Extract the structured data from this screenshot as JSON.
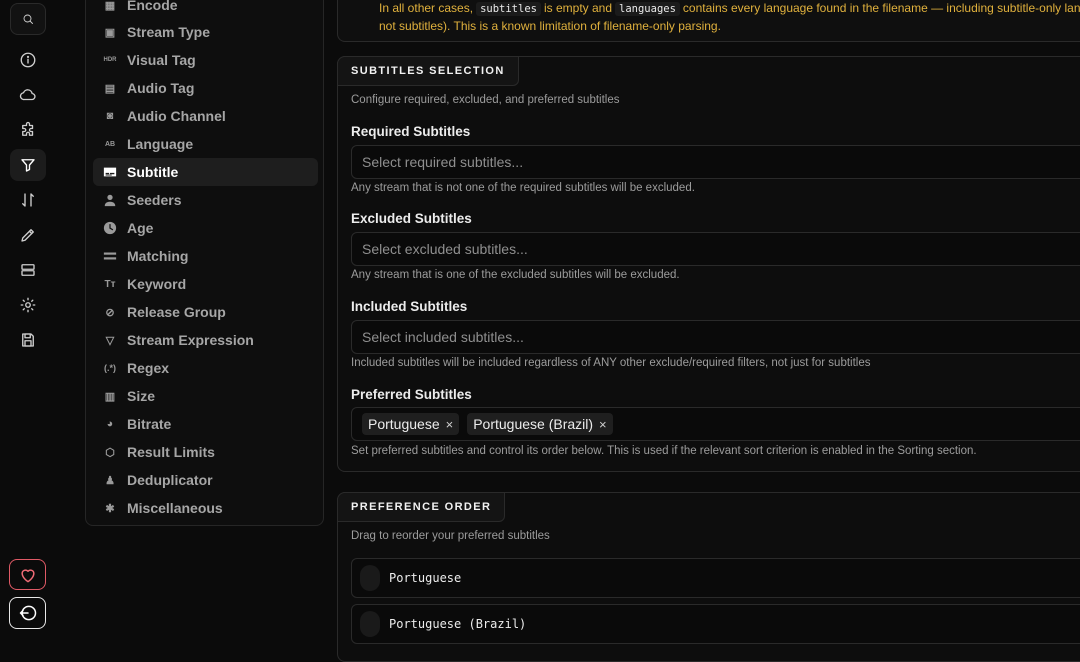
{
  "notice": {
    "line1_pre": "In all other cases,",
    "code1": "subtitles",
    "line1_mid": "is empty and",
    "code2": "languages",
    "line1_post": "contains every language found in the filename — including subtitle-only langu",
    "line2": "not subtitles). This is a known limitation of filename-only parsing."
  },
  "nav": {
    "items": [
      {
        "label": "Encode",
        "icon": "film-icon"
      },
      {
        "label": "Stream Type",
        "icon": "stream-type-icon"
      },
      {
        "label": "Visual Tag",
        "icon": "hdr-icon"
      },
      {
        "label": "Audio Tag",
        "icon": "speaker-icon"
      },
      {
        "label": "Audio Channel",
        "icon": "surround-icon"
      },
      {
        "label": "Language",
        "icon": "language-icon"
      },
      {
        "label": "Subtitle",
        "icon": "subtitle-icon"
      },
      {
        "label": "Seeders",
        "icon": "person-icon"
      },
      {
        "label": "Age",
        "icon": "clock-icon"
      },
      {
        "label": "Matching",
        "icon": "equals-icon"
      },
      {
        "label": "Keyword",
        "icon": "text-icon"
      },
      {
        "label": "Release Group",
        "icon": "group-off-icon"
      },
      {
        "label": "Stream Expression",
        "icon": "filter-code-icon"
      },
      {
        "label": "Regex",
        "icon": "regex-icon"
      },
      {
        "label": "Size",
        "icon": "file-size-icon"
      },
      {
        "label": "Bitrate",
        "icon": "speedometer-icon"
      },
      {
        "label": "Result Limits",
        "icon": "cube-icon"
      },
      {
        "label": "Deduplicator",
        "icon": "stamp-icon"
      },
      {
        "label": "Miscellaneous",
        "icon": "shapes-icon"
      }
    ],
    "active": "Subtitle"
  },
  "subtitles_selection": {
    "title": "SUBTITLES SELECTION",
    "description": "Configure required, excluded, and preferred subtitles",
    "required": {
      "label": "Required Subtitles",
      "placeholder": "Select required subtitles...",
      "help": "Any stream that is not one of the required subtitles will be excluded."
    },
    "excluded": {
      "label": "Excluded Subtitles",
      "placeholder": "Select excluded subtitles...",
      "help": "Any stream that is one of the excluded subtitles will be excluded."
    },
    "included": {
      "label": "Included Subtitles",
      "placeholder": "Select included subtitles...",
      "help": "Included subtitles will be included regardless of ANY other exclude/required filters, not just for subtitles"
    },
    "preferred": {
      "label": "Preferred Subtitles",
      "chips": [
        "Portuguese",
        "Portuguese (Brazil)"
      ],
      "remove_glyph": "×",
      "help": "Set preferred subtitles and control its order below. This is used if the relevant sort criterion is enabled in the Sorting section."
    }
  },
  "preference_order": {
    "title": "PREFERENCE ORDER",
    "description": "Drag to reorder your preferred subtitles",
    "items": [
      "Portuguese",
      "Portuguese (Brazil)"
    ]
  },
  "colors": {
    "accent_warning": "#e0b13d",
    "heart": "#f06b76",
    "background": "#0b0b0b"
  }
}
